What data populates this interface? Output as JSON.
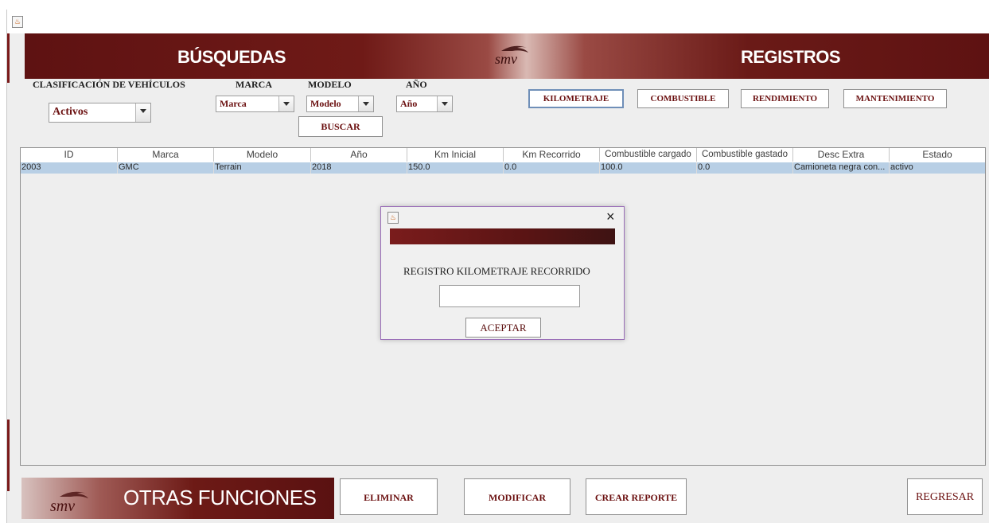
{
  "header": {
    "busquedas": "BÚSQUEDAS",
    "registros": "REGISTROS",
    "logo_text": "smv"
  },
  "filters": {
    "clasificacion": {
      "label": "CLASIFICACIÓN DE VEHÍCULOS",
      "value": "Activos"
    },
    "marca": {
      "label": "MARCA",
      "value": "Marca"
    },
    "modelo": {
      "label": "MODELO",
      "value": "Modelo"
    },
    "anio": {
      "label": "AÑO",
      "value": "Año"
    },
    "buscar_label": "BUSCAR"
  },
  "registros_buttons": [
    "KILOMETRAJE",
    "COMBUSTIBLE",
    "RENDIMIENTO",
    "MANTENIMIENTO"
  ],
  "table": {
    "columns": [
      "ID",
      "Marca",
      "Modelo",
      "Año",
      "Km Inicial",
      "Km Recorrido",
      "Combustible cargado",
      "Combustible gastado",
      "Desc Extra",
      "Estado"
    ],
    "rows": [
      [
        "2003",
        "GMC",
        "Terrain",
        "2018",
        "150.0",
        "0.0",
        "100.0",
        "0.0",
        "Camioneta negra con...",
        "activo"
      ]
    ]
  },
  "dialog": {
    "title": "REGISTRO KILOMETRAJE RECORRIDO",
    "input_value": "",
    "accept_label": "ACEPTAR",
    "close_glyph": "×"
  },
  "footer": {
    "title": "OTRAS FUNCIONES",
    "eliminar": "ELIMINAR",
    "modificar": "MODIFICAR",
    "crear_reporte": "CREAR REPORTE",
    "regresar": "REGRESAR"
  },
  "colors": {
    "maroon": "#6b1010",
    "selection": "#b8cfe5",
    "dialog_border": "#9b6fb8"
  },
  "icons": [
    "java-app-icon",
    "close-icon",
    "dropdown-arrow-icon",
    "smv-logo"
  ]
}
